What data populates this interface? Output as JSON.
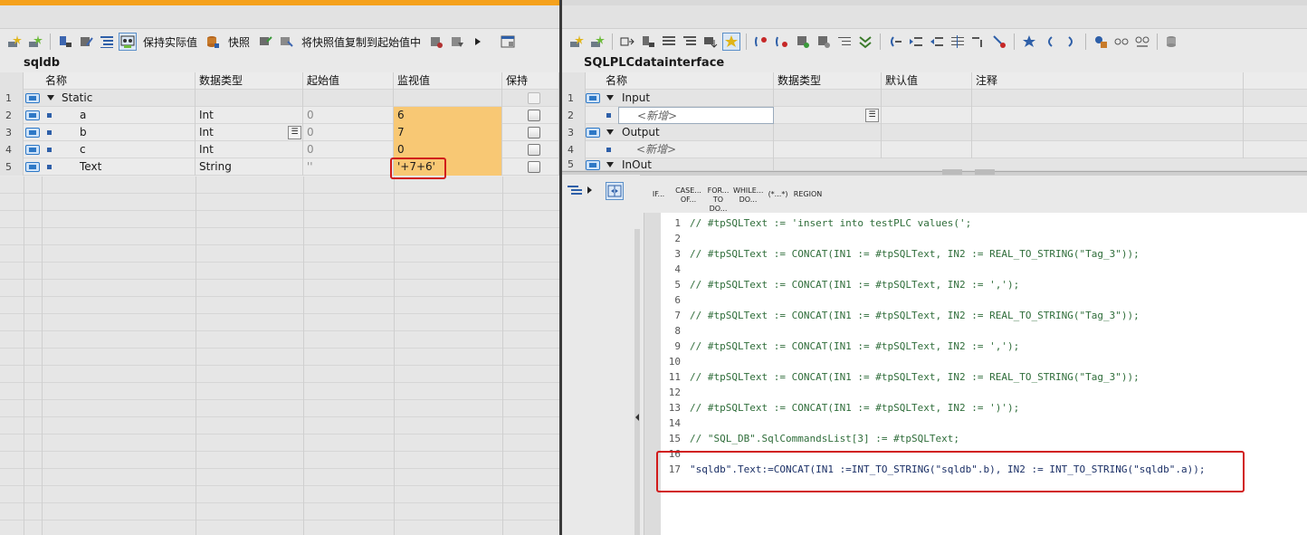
{
  "colors": {
    "accent_bar": "#f5a11c",
    "monitor_cell": "#f8c874",
    "highlight_box": "#d11a1a"
  },
  "left": {
    "toolbar": {
      "icons": [
        "add-row-icon",
        "insert-row-icon",
        "monitor-icon",
        "edit-icon",
        "expand-icon",
        "monitor-all-icon",
        "db-icon",
        "snapshot-load-icon",
        "snapshot-store-icon",
        "copy-snapshot-icon",
        "reset-icon",
        "more-icon",
        "layout-icon"
      ],
      "keep_actual_label": "保持实际值",
      "snapshot_label": "快照",
      "copy_snapshot_label": "将快照值复制到起始值中"
    },
    "title": "sqldb",
    "columns": [
      "名称",
      "数据类型",
      "起始值",
      "监视值",
      "保持"
    ],
    "rows": [
      {
        "num": "1",
        "name": "Static",
        "type": "",
        "start": "",
        "monitor": ""
      },
      {
        "num": "2",
        "name": "a",
        "type": "Int",
        "start": "0",
        "monitor": "6"
      },
      {
        "num": "3",
        "name": "b",
        "type": "Int",
        "start": "0",
        "monitor": "7"
      },
      {
        "num": "4",
        "name": "c",
        "type": "Int",
        "start": "0",
        "monitor": "0"
      },
      {
        "num": "5",
        "name": "Text",
        "type": "String",
        "start": "''",
        "monitor": "'+7+6'"
      }
    ]
  },
  "right": {
    "title": "SQLPLCdatainterface",
    "columns": [
      "名称",
      "数据类型",
      "默认值",
      "注释"
    ],
    "rows": [
      {
        "num": "1",
        "name": "Input"
      },
      {
        "num": "2",
        "name": "<新增>"
      },
      {
        "num": "3",
        "name": "Output"
      },
      {
        "num": "4",
        "name": "<新增>"
      },
      {
        "num": "5",
        "name": "InOut"
      }
    ],
    "snippets": [
      {
        "l1": "IF...",
        "l2": ""
      },
      {
        "l1": "CASE...",
        "l2": "OF..."
      },
      {
        "l1": "FOR...",
        "l2": "TO DO..."
      },
      {
        "l1": "WHILE...",
        "l2": "DO..."
      },
      {
        "l1": "(*...*)",
        "l2": ""
      },
      {
        "l1": "REGION",
        "l2": ""
      }
    ],
    "code_lines": [
      {
        "n": "1",
        "text": "// #tpSQLText := 'insert into testPLC values(';"
      },
      {
        "n": "2",
        "text": ""
      },
      {
        "n": "3",
        "text": "// #tpSQLText := CONCAT(IN1 := #tpSQLText, IN2 := REAL_TO_STRING(\"Tag_3\"));"
      },
      {
        "n": "4",
        "text": ""
      },
      {
        "n": "5",
        "text": "// #tpSQLText := CONCAT(IN1 := #tpSQLText, IN2 := ',');"
      },
      {
        "n": "6",
        "text": ""
      },
      {
        "n": "7",
        "text": "// #tpSQLText := CONCAT(IN1 := #tpSQLText, IN2 := REAL_TO_STRING(\"Tag_3\"));"
      },
      {
        "n": "8",
        "text": ""
      },
      {
        "n": "9",
        "text": "// #tpSQLText := CONCAT(IN1 := #tpSQLText, IN2 := ',');"
      },
      {
        "n": "10",
        "text": ""
      },
      {
        "n": "11",
        "text": "// #tpSQLText := CONCAT(IN1 := #tpSQLText, IN2 := REAL_TO_STRING(\"Tag_3\"));"
      },
      {
        "n": "12",
        "text": ""
      },
      {
        "n": "13",
        "text": "// #tpSQLText := CONCAT(IN1 := #tpSQLText, IN2 := ')');"
      },
      {
        "n": "14",
        "text": ""
      },
      {
        "n": "15",
        "text": "// \"SQL_DB\".SqlCommandsList[3] := #tpSQLText;"
      },
      {
        "n": "16",
        "text": ""
      },
      {
        "n": "17",
        "text": "\"sqldb\".Text:=CONCAT(IN1 :=INT_TO_STRING(\"sqldb\".b), IN2 := INT_TO_STRING(\"sqldb\".a));"
      }
    ]
  }
}
